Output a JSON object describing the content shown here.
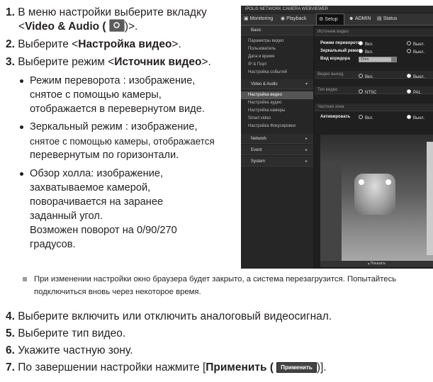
{
  "steps": {
    "s1": {
      "num": "1.",
      "line1": "В меню настройки выберите вкладку",
      "line2_pre": "<",
      "line2_bold": "Video & Audio (",
      "line2_post": ")>."
    },
    "s2": {
      "num": "2.",
      "pre": "Выберите <",
      "bold": "Настройка видео",
      "post": ">."
    },
    "s3": {
      "num": "3.",
      "pre": "Выберите режим <",
      "bold": "Источник видео",
      "post": ">."
    },
    "s4": {
      "num": "4.",
      "text": "Выберите включить или отключить аналоговый видеосигнал."
    },
    "s5": {
      "num": "5.",
      "text": "Выберите тип видео."
    },
    "s6": {
      "num": "6.",
      "text": "Укажите частную зону."
    },
    "s7": {
      "num": "7.",
      "pre": "По завершении настройки нажмите [",
      "bold": "Применить (",
      "btn": "Применить",
      "post": ")]."
    }
  },
  "bullets": {
    "b1": [
      "Режим переворота : изображение,",
      "снятое с помощью камеры,",
      "отображается в перевернутом виде."
    ],
    "b2": [
      "Зеркальный режим : изображение,",
      "снятое с помощью камеры, отображается",
      "перевернутым по горизонтали."
    ],
    "b3": [
      "Обзор холла: изображение,",
      "захватываемое камерой,",
      "поворачивается на заранее",
      "заданный угол.",
      "Возможен поворот на 0/90/270",
      "градусов."
    ]
  },
  "note": [
    "При изменении настройки окно браузера будет закрыто, а система перезагрузится. Попытайтесь",
    "подключиться вновь через некоторое время."
  ],
  "shot": {
    "title": "iPOLiS NETWORK CAMERA WEBVIEWER",
    "tabs": {
      "monitoring": "Monitoring",
      "playback": "Playback",
      "setup": "Setup",
      "admin": "ADMIN",
      "status": "Status"
    },
    "sidebar": {
      "basic": "Basic",
      "basic_items": [
        "Параметры видео",
        "Пользователь",
        "Дата и время",
        "IP & Порт",
        "Настройка событий"
      ],
      "va": "Video & Audio",
      "va_items": [
        "Настройка видео",
        "Настройка аудио",
        "Настройка камеры",
        "Smart video",
        "Настройка Фокусировки"
      ],
      "network": "Network",
      "event": "Event",
      "system": "System"
    },
    "main": {
      "h_source": "Источник видео",
      "flip": "Режим переворота",
      "mirror": "Зеркальный режим",
      "hallway": "Вид коридора",
      "on": "Вкл.",
      "off": "Выкл.",
      "select": "Откл.",
      "h_out": "Видео выход",
      "h_type": "Тип видео",
      "ntsc": "NTSC",
      "pal": "PAL",
      "h_privacy": "Частная зона",
      "activate": "Активировать",
      "show": "Показать"
    }
  }
}
